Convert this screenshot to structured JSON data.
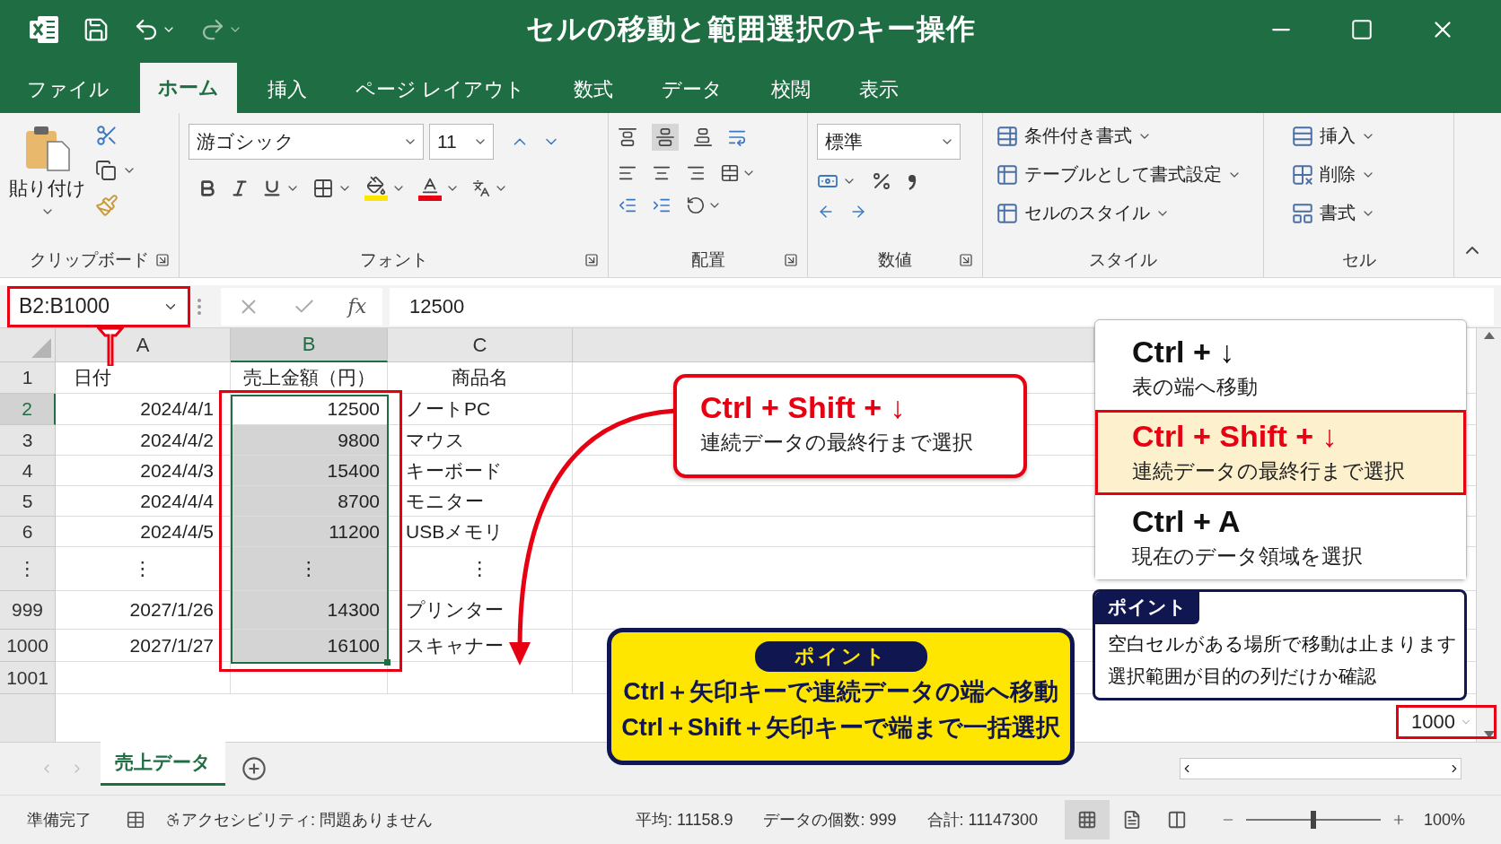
{
  "window": {
    "title": "セルの移動と範囲選択のキー操作"
  },
  "tabs": [
    {
      "label": "ファイル",
      "selected": false
    },
    {
      "label": "ホーム",
      "selected": true
    },
    {
      "label": "挿入",
      "selected": false
    },
    {
      "label": "ページ レイアウト",
      "selected": false
    },
    {
      "label": "数式",
      "selected": false
    },
    {
      "label": "データ",
      "selected": false
    },
    {
      "label": "校閲",
      "selected": false
    },
    {
      "label": "表示",
      "selected": false
    }
  ],
  "ribbon": {
    "clipboard": {
      "paste": "貼り付け",
      "label": "クリップボード"
    },
    "font": {
      "name": "游ゴシック",
      "size": "11",
      "label": "フォント"
    },
    "alignment": {
      "label": "配置"
    },
    "number": {
      "format": "標準",
      "label": "数値"
    },
    "styles": {
      "items": [
        "条件付き書式",
        "テーブルとして書式設定",
        "セルのスタイル"
      ],
      "label": "スタイル"
    },
    "cells": {
      "items": [
        "挿入",
        "削除",
        "書式"
      ],
      "label": "セル"
    }
  },
  "formula_bar": {
    "name_box": "B2:B1000",
    "function_label": "fx",
    "value": "12500"
  },
  "sheet": {
    "columns": [
      {
        "label": "A",
        "selected": false
      },
      {
        "label": "B",
        "selected": true
      },
      {
        "label": "C",
        "selected": false
      }
    ],
    "rows": [
      {
        "header": "1",
        "kind": "header",
        "selected": false,
        "in_range": false,
        "cells": [
          "日付",
          "売上金額（円）",
          "商品名"
        ]
      },
      {
        "header": "2",
        "kind": "data",
        "selected": true,
        "in_range": false,
        "cells": [
          "2024/4/1",
          "12500",
          "ノートPC"
        ]
      },
      {
        "header": "3",
        "kind": "data",
        "selected": false,
        "in_range": true,
        "cells": [
          "2024/4/2",
          "9800",
          "マウス"
        ]
      },
      {
        "header": "4",
        "kind": "data",
        "selected": false,
        "in_range": true,
        "cells": [
          "2024/4/3",
          "15400",
          "キーボード"
        ]
      },
      {
        "header": "5",
        "kind": "data",
        "selected": false,
        "in_range": true,
        "cells": [
          "2024/4/4",
          "8700",
          "モニター"
        ]
      },
      {
        "header": "6",
        "kind": "data",
        "selected": false,
        "in_range": true,
        "cells": [
          "2024/4/5",
          "11200",
          "USBメモリ"
        ]
      },
      {
        "header": "⋮",
        "kind": "ellipsis",
        "selected": false,
        "in_range": true,
        "cells": [
          "⋮",
          "⋮",
          "⋮"
        ]
      },
      {
        "header": "999",
        "kind": "data",
        "selected": false,
        "in_range": true,
        "cells": [
          "2027/1/26",
          "14300",
          "プリンター"
        ]
      },
      {
        "header": "1000",
        "kind": "data",
        "selected": false,
        "in_range": true,
        "cells": [
          "2027/1/27",
          "16100",
          "スキャナー"
        ]
      },
      {
        "header": "1001",
        "kind": "empty",
        "selected": false,
        "in_range": false
      }
    ]
  },
  "callout": {
    "keys": "Ctrl + Shift + ↓",
    "text": "連続データの最終行まで選択"
  },
  "shortcuts": [
    {
      "keys": "Ctrl + ↓",
      "description": "表の端へ移動",
      "selected": false
    },
    {
      "keys": "Ctrl + Shift + ↓",
      "description": "連続データの最終行まで選択",
      "selected": true
    },
    {
      "keys": "Ctrl + A",
      "description": "現在のデータ領域を選択",
      "selected": false
    }
  ],
  "point_box": {
    "label": "ポイント",
    "lines": [
      "空白セルがある場所で移動は止まります",
      "選択範囲が目的の列だけか確認"
    ]
  },
  "summary_box": {
    "label": "ポイント",
    "lines": [
      "Ctrl＋矢印キーで連続データの端へ移動",
      "Ctrl＋Shift＋矢印キーで端まで一括選択"
    ]
  },
  "row_jump": {
    "value": "1000"
  },
  "sheet_tabs": [
    {
      "label": "売上データ",
      "selected": true
    }
  ],
  "status_bar": {
    "ready": "準備完了",
    "accessibility": "アクセシビリティ: 問題ありません",
    "average": "平均: 11158.9",
    "count": "データの個数: 999",
    "sum": "合計: 11147300",
    "views": [
      {
        "kind": "normal",
        "selected": true
      },
      {
        "kind": "layout",
        "selected": false
      },
      {
        "kind": "break",
        "selected": false
      }
    ],
    "zoom": {
      "level": 0.5,
      "label": "100%"
    }
  }
}
